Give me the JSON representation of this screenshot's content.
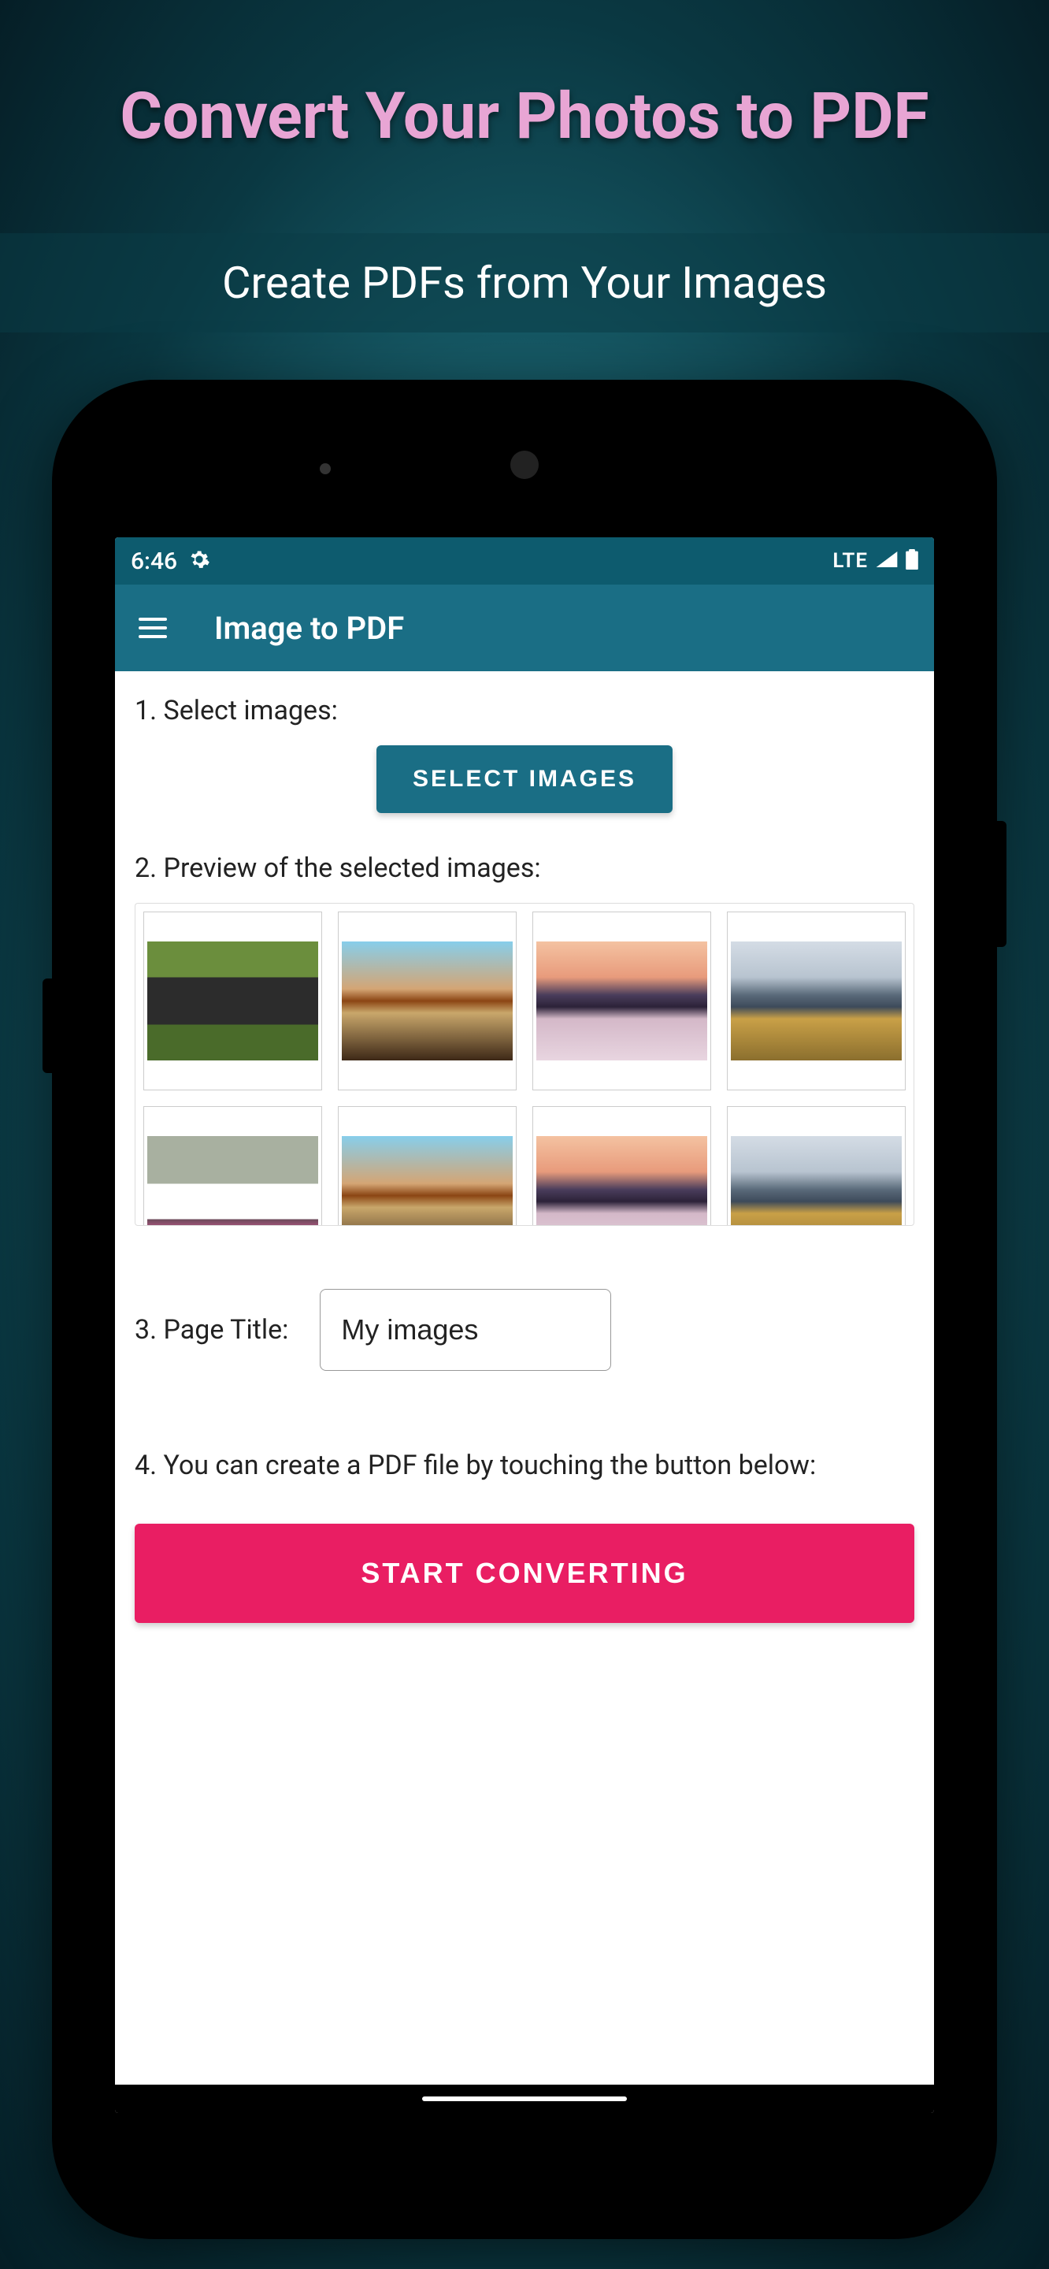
{
  "promo": {
    "title": "Convert Your Photos to PDF",
    "subtitle": "Create PDFs from Your Images"
  },
  "statusBar": {
    "time": "6:46",
    "network": "LTE"
  },
  "appBar": {
    "title": "Image to PDF"
  },
  "steps": {
    "step1Label": "1. Select images:",
    "selectButton": "SELECT IMAGES",
    "step2Label": "2. Preview of the selected images:",
    "step3Label": "3. Page Title:",
    "pageTitleValue": "My images",
    "step4Label": "4. You can create a PDF file by touching the button below:",
    "convertButton": "START CONVERTING"
  }
}
